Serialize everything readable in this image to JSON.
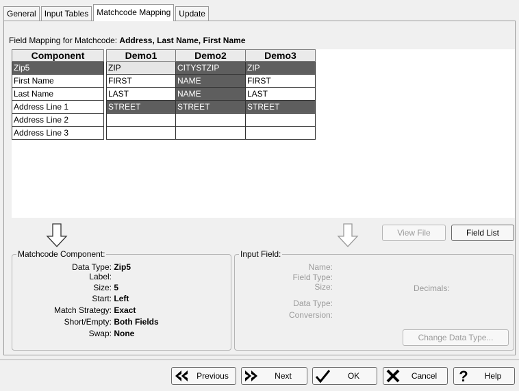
{
  "tabs": [
    {
      "label": "General"
    },
    {
      "label": "Input Tables"
    },
    {
      "label": "Matchcode Mapping"
    },
    {
      "label": "Update"
    }
  ],
  "mapping": {
    "prefix": "Field Mapping for Matchcode: ",
    "matchcode": "Address, Last Name, First Name"
  },
  "components": {
    "header": "Component",
    "items": [
      "Zip5",
      "First Name",
      "Last Name",
      "Address Line 1",
      "Address Line 2",
      "Address Line 3"
    ]
  },
  "grid": {
    "headers": [
      "Demo1",
      "Demo2",
      "Demo3"
    ],
    "rows": [
      [
        "ZIP",
        "CITYSTZIP",
        "ZIP"
      ],
      [
        "FIRST",
        "NAME",
        "FIRST"
      ],
      [
        "LAST",
        "NAME",
        "LAST"
      ],
      [
        "STREET",
        "STREET",
        "STREET"
      ],
      [
        "",
        "",
        ""
      ],
      [
        "",
        "",
        ""
      ]
    ]
  },
  "buttons": {
    "view_file": "View File",
    "field_list": "Field List",
    "change_data_type": "Change Data Type...",
    "previous": "Previous",
    "next": "Next",
    "ok": "OK",
    "cancel": "Cancel",
    "help": "Help"
  },
  "matchcode_component": {
    "legend": "Matchcode Component:",
    "data_type_label": "Data Type:",
    "data_type": "Zip5",
    "label_label": "Label:",
    "label": "",
    "size_label": "Size:",
    "size": "5",
    "start_label": "Start:",
    "start": "Left",
    "strategy_label": "Match Strategy:",
    "strategy": "Exact",
    "short_label": "Short/Empty:",
    "short": "Both Fields",
    "swap_label": "Swap:",
    "swap": "None"
  },
  "input_field": {
    "legend": "Input Field:",
    "name_label": "Name:",
    "field_type_label": "Field Type:",
    "size_label": "Size:",
    "decimals_label": "Decimals:",
    "data_type_label": "Data Type:",
    "conversion_label": "Conversion:"
  },
  "colors": {
    "selected_row": "#5e5e5e",
    "panel_bg": "#ffffff",
    "dialog_bg": "#f0f0f0"
  },
  "icons": [
    "arrow-down-icon",
    "arrow-down-disabled-icon",
    "previous-icon",
    "next-icon",
    "check-icon",
    "x-icon",
    "question-icon"
  ]
}
